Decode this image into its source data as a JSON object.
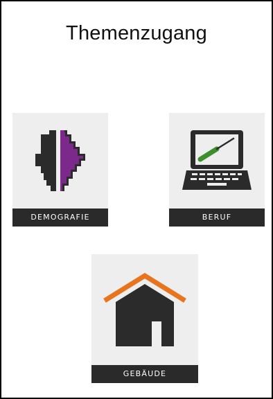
{
  "page": {
    "title": "Themenzugang"
  },
  "tiles": [
    {
      "label": "DEMOGRAFIE",
      "icon": "demographics-icon"
    },
    {
      "label": "BERUF",
      "icon": "laptop-screwdriver-icon"
    },
    {
      "label": "GEBÄUDE",
      "icon": "house-icon"
    }
  ],
  "colors": {
    "tile_bg": "#eeeeee",
    "label_bg": "#2a2a2a",
    "dark_icon": "#2b2b2b",
    "purple": "#7b2a8c",
    "green": "#3d8f2b",
    "roof_orange": "#e8741e"
  }
}
